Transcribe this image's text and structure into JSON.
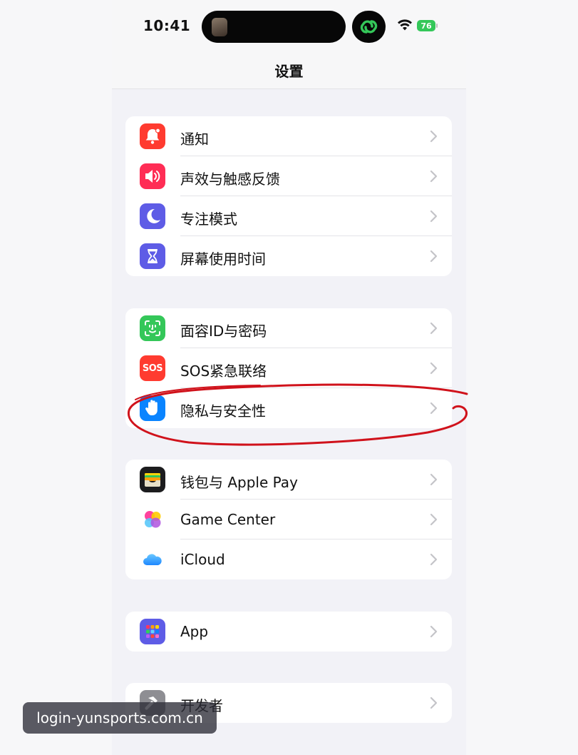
{
  "status_bar": {
    "time": "10:41",
    "battery": "76"
  },
  "nav": {
    "title": "设置"
  },
  "groups": [
    {
      "items": [
        {
          "label": "通知",
          "icon": "bell-icon",
          "color": "#ff3b30"
        },
        {
          "label": "声效与触感反馈",
          "icon": "speaker-icon",
          "color": "#ff2d55"
        },
        {
          "label": "专注模式",
          "icon": "moon-icon",
          "color": "#5e5ce6"
        },
        {
          "label": "屏幕使用时间",
          "icon": "hourglass-icon",
          "color": "#5e5ce6"
        }
      ]
    },
    {
      "items": [
        {
          "label": "面容ID与密码",
          "icon": "face-id-icon",
          "color": "#34c759"
        },
        {
          "label": "SOS紧急联络",
          "icon": "sos-icon",
          "icon_text": "SOS",
          "color": "#ff3b30"
        },
        {
          "label": "隐私与安全性",
          "icon": "hand-icon",
          "color": "#0a84ff"
        }
      ]
    },
    {
      "items": [
        {
          "label": "钱包与 Apple Pay",
          "icon": "wallet-icon",
          "color": "#1c1c1e"
        },
        {
          "label": "Game Center",
          "icon": "game-center-icon",
          "color": "#ffffff"
        },
        {
          "label": "iCloud",
          "icon": "cloud-icon",
          "color": "#ffffff"
        }
      ]
    },
    {
      "items": [
        {
          "label": "App",
          "icon": "app-grid-icon",
          "color": "#5e5ce6"
        }
      ]
    },
    {
      "items": [
        {
          "label": "开发者",
          "icon": "hammer-icon",
          "color": "#8e8e93"
        }
      ]
    }
  ],
  "annotation": {
    "color": "#d0121b"
  },
  "watermark": {
    "text": "login-yunsports.com.cn"
  }
}
